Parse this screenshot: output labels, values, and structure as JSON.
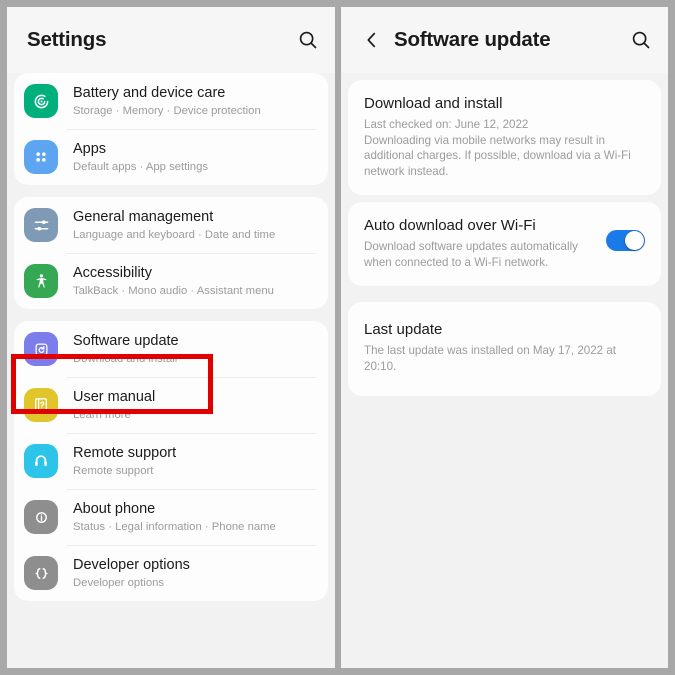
{
  "left_panel": {
    "header": {
      "title": "Settings",
      "search_icon": "search-icon"
    },
    "groups": [
      {
        "items": [
          {
            "icon": "battery-device-care-icon",
            "icon_color": "#00b07c",
            "title": "Battery and device care",
            "subtitle": "Storage  ·  Memory  ·  Device protection"
          },
          {
            "icon": "apps-grid-icon",
            "icon_color": "#5da5f0",
            "title": "Apps",
            "subtitle": "Default apps  ·  App settings"
          }
        ]
      },
      {
        "items": [
          {
            "icon": "sliders-icon",
            "icon_color": "#7f9ab5",
            "title": "General management",
            "subtitle": "Language and keyboard  ·  Date and time"
          },
          {
            "icon": "accessibility-person-icon",
            "icon_color": "#34a853",
            "title": "Accessibility",
            "subtitle": "TalkBack  ·  Mono audio  ·  Assistant menu"
          }
        ]
      },
      {
        "items": [
          {
            "icon": "software-update-refresh-icon",
            "icon_color": "#7c7ceb",
            "title": "Software update",
            "subtitle": "Download and install"
          },
          {
            "icon": "user-manual-book-icon",
            "icon_color": "#e0c62b",
            "title": "User manual",
            "subtitle": "Learn more"
          },
          {
            "icon": "remote-support-headset-icon",
            "icon_color": "#2cc4e8",
            "title": "Remote support",
            "subtitle": "Remote support"
          },
          {
            "icon": "about-phone-info-icon",
            "icon_color": "#8e8e8e",
            "title": "About phone",
            "subtitle": "Status  ·  Legal information  ·  Phone name"
          },
          {
            "icon": "developer-options-brackets-icon",
            "icon_color": "#8e8e8e",
            "title": "Developer options",
            "subtitle": "Developer options"
          }
        ]
      }
    ]
  },
  "right_panel": {
    "header": {
      "back_icon": "chevron-left-icon",
      "title": "Software update",
      "search_icon": "search-icon"
    },
    "download_and_install": {
      "title": "Download and install",
      "last_checked": "Last checked on: June 12, 2022",
      "description": "Downloading via mobile networks may result in additional charges. If possible, download via a Wi-Fi network instead."
    },
    "auto_download": {
      "title": "Auto download over Wi-Fi",
      "description": "Download software updates automatically when connected to a Wi-Fi network.",
      "toggle_state": "on"
    },
    "last_update": {
      "title": "Last update",
      "description": "The last update was installed on May 17, 2022 at 20:10."
    }
  },
  "annotations": {
    "highlight_color": "#e00000",
    "boxes": [
      "software-update-row-highlight",
      "download-and-install-highlight"
    ]
  }
}
